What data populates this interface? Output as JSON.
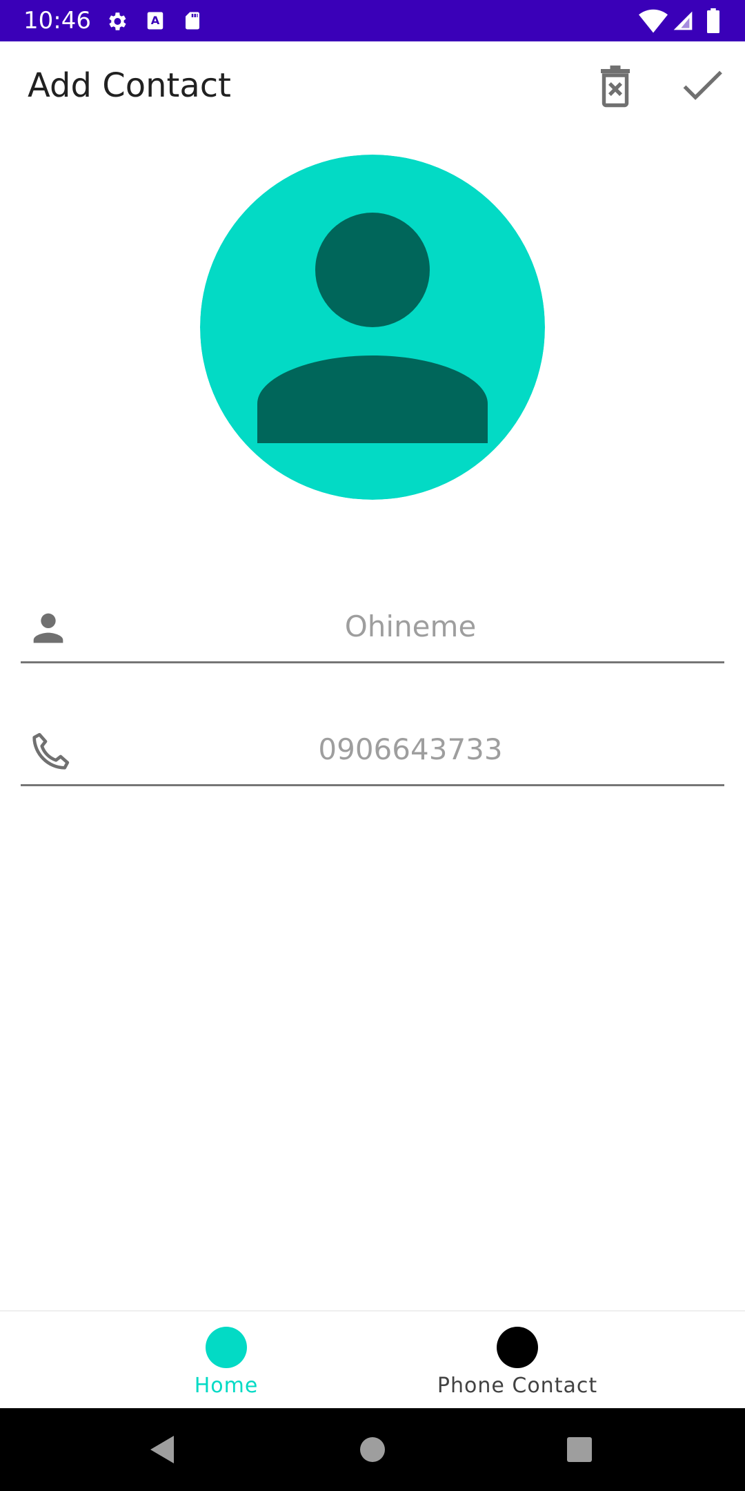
{
  "status_bar": {
    "time": "10:46",
    "icons_left": [
      "settings-icon",
      "text-a-icon",
      "sd-card-icon"
    ],
    "icons_right": [
      "wifi-icon",
      "cell-signal-icon",
      "battery-icon"
    ],
    "background": "#3a00b8"
  },
  "app_bar": {
    "title": "Add Contact",
    "actions": [
      "delete-icon",
      "check-icon"
    ]
  },
  "avatar": {
    "icon": "person-icon",
    "background": "#03dac5",
    "foreground": "#00665a"
  },
  "form": {
    "name": {
      "placeholder": "Ohineme",
      "value": "",
      "icon": "person-icon"
    },
    "phone": {
      "placeholder": "0906643733",
      "value": "",
      "icon": "phone-icon"
    }
  },
  "bottom_nav": {
    "items": [
      {
        "label": "Home",
        "selected": true,
        "color": "#03dac5"
      },
      {
        "label": "Phone Contact",
        "selected": false,
        "color": "#000000"
      }
    ]
  },
  "system_nav": [
    "back-icon",
    "home-icon",
    "recents-icon"
  ]
}
